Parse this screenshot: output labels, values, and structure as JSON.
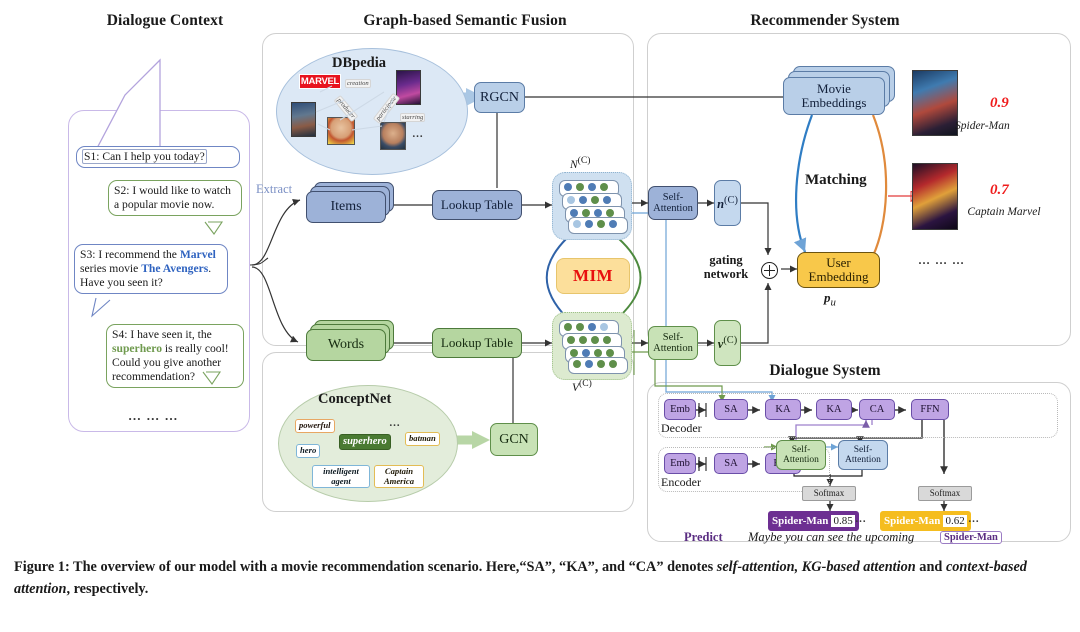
{
  "sections": {
    "dialogue_context": "Dialogue Context",
    "graph_fusion": "Graph-based Semantic Fusion",
    "recommender": "Recommender System",
    "dialogue_system": "Dialogue System"
  },
  "dialogue": {
    "turns": [
      {
        "id": "S1",
        "speaker": "system",
        "text": "S1: Can I help you today?"
      },
      {
        "id": "S2",
        "speaker": "user",
        "text": "S2: I would like to watch a popular movie now."
      },
      {
        "id": "S3",
        "speaker": "system",
        "text": "S3: I recommend the Marvel series movie The Avengers. Have you seen it?"
      },
      {
        "id": "S4",
        "speaker": "user",
        "text": "S4: I have seen it, the superhero is really cool! Could you give another recommendation?"
      }
    ],
    "s3_parts": {
      "pre": "S3: I recommend the ",
      "kw1": "Marvel",
      "mid": " series movie ",
      "kw2": "The Avengers",
      "post": ". Have you seen it?"
    },
    "s4_parts": {
      "pre": "S4: I have seen it, the ",
      "kw": "superhero",
      "post": " is really cool! Could you give another recommendation?"
    },
    "ellipsis": "… … …"
  },
  "kg": {
    "dbpedia": {
      "title": "DBpedia",
      "brand": "MARVEL",
      "relations": [
        "creation",
        "producer",
        "participate",
        "starring"
      ],
      "ellipsis": "…"
    },
    "conceptnet": {
      "title": "ConceptNet",
      "center": "superhero",
      "nodes": [
        "powerful",
        "hero",
        "batman",
        "intelligent agent",
        "Captain America"
      ],
      "ellipsis": "…"
    }
  },
  "fusion": {
    "extract_label": "Extract",
    "items": "Items",
    "words": "Words",
    "lookup_table": "Lookup Table",
    "rgcn": "RGCN",
    "gcn": "GCN",
    "mim": "MIM",
    "n_c": "N",
    "n_c_sup": "(C)",
    "v_c": "V",
    "v_c_sup": "(C)"
  },
  "recommender": {
    "self_attention": "Self-Attention",
    "n_vec": "n",
    "n_vec_sup": "(C)",
    "v_vec": "v",
    "v_vec_sup": "(C)",
    "gating_network": "gating network",
    "user_embedding": "User Embedding",
    "p_u": "p",
    "p_u_sub": "u",
    "movie_embeddings": "Movie Embeddings",
    "matching": "Matching",
    "results": [
      {
        "score": "0.9",
        "name": "Spider-Man"
      },
      {
        "score": "0.7",
        "name": "Captain Marvel"
      }
    ],
    "ellipsis": "… … …"
  },
  "dialogue_system": {
    "decoder_label": "Decoder",
    "encoder_label": "Encoder",
    "decoder_blocks": [
      "Emb",
      "SA",
      "KA",
      "KA",
      "CA",
      "FFN"
    ],
    "encoder_blocks": [
      "Emb",
      "SA",
      "FFN"
    ],
    "self_attention": "Self-Attention",
    "softmax": "Softmax",
    "copy_tokens": [
      {
        "word": "Spider-Man",
        "value": "0.85",
        "color": "#6d2f92"
      },
      {
        "word": "Spider-Man",
        "value": "0.62",
        "color": "#f5bd1f"
      }
    ],
    "token_ellipsis": "…",
    "predict_label": "Predict",
    "predict_text": "Maybe you can see the upcoming",
    "predict_token": "Spider-Man"
  },
  "caption": {
    "prefix": "Figure 1: The overview of our model with a movie recommendation scenario. Here,“SA”, “KA”, and “CA” denotes ",
    "em1": "self-attention, KG-based attention",
    "mid": " and ",
    "em2": "context-based attention",
    "suffix": ", respectively."
  },
  "colors": {
    "blue_node": "#9db2d8",
    "green_node": "#b5d6a0",
    "gold": "#f8c84a",
    "purple": "#bfa4e4",
    "mim_text": "#e8100f",
    "score_red": "#ef1c1c"
  }
}
